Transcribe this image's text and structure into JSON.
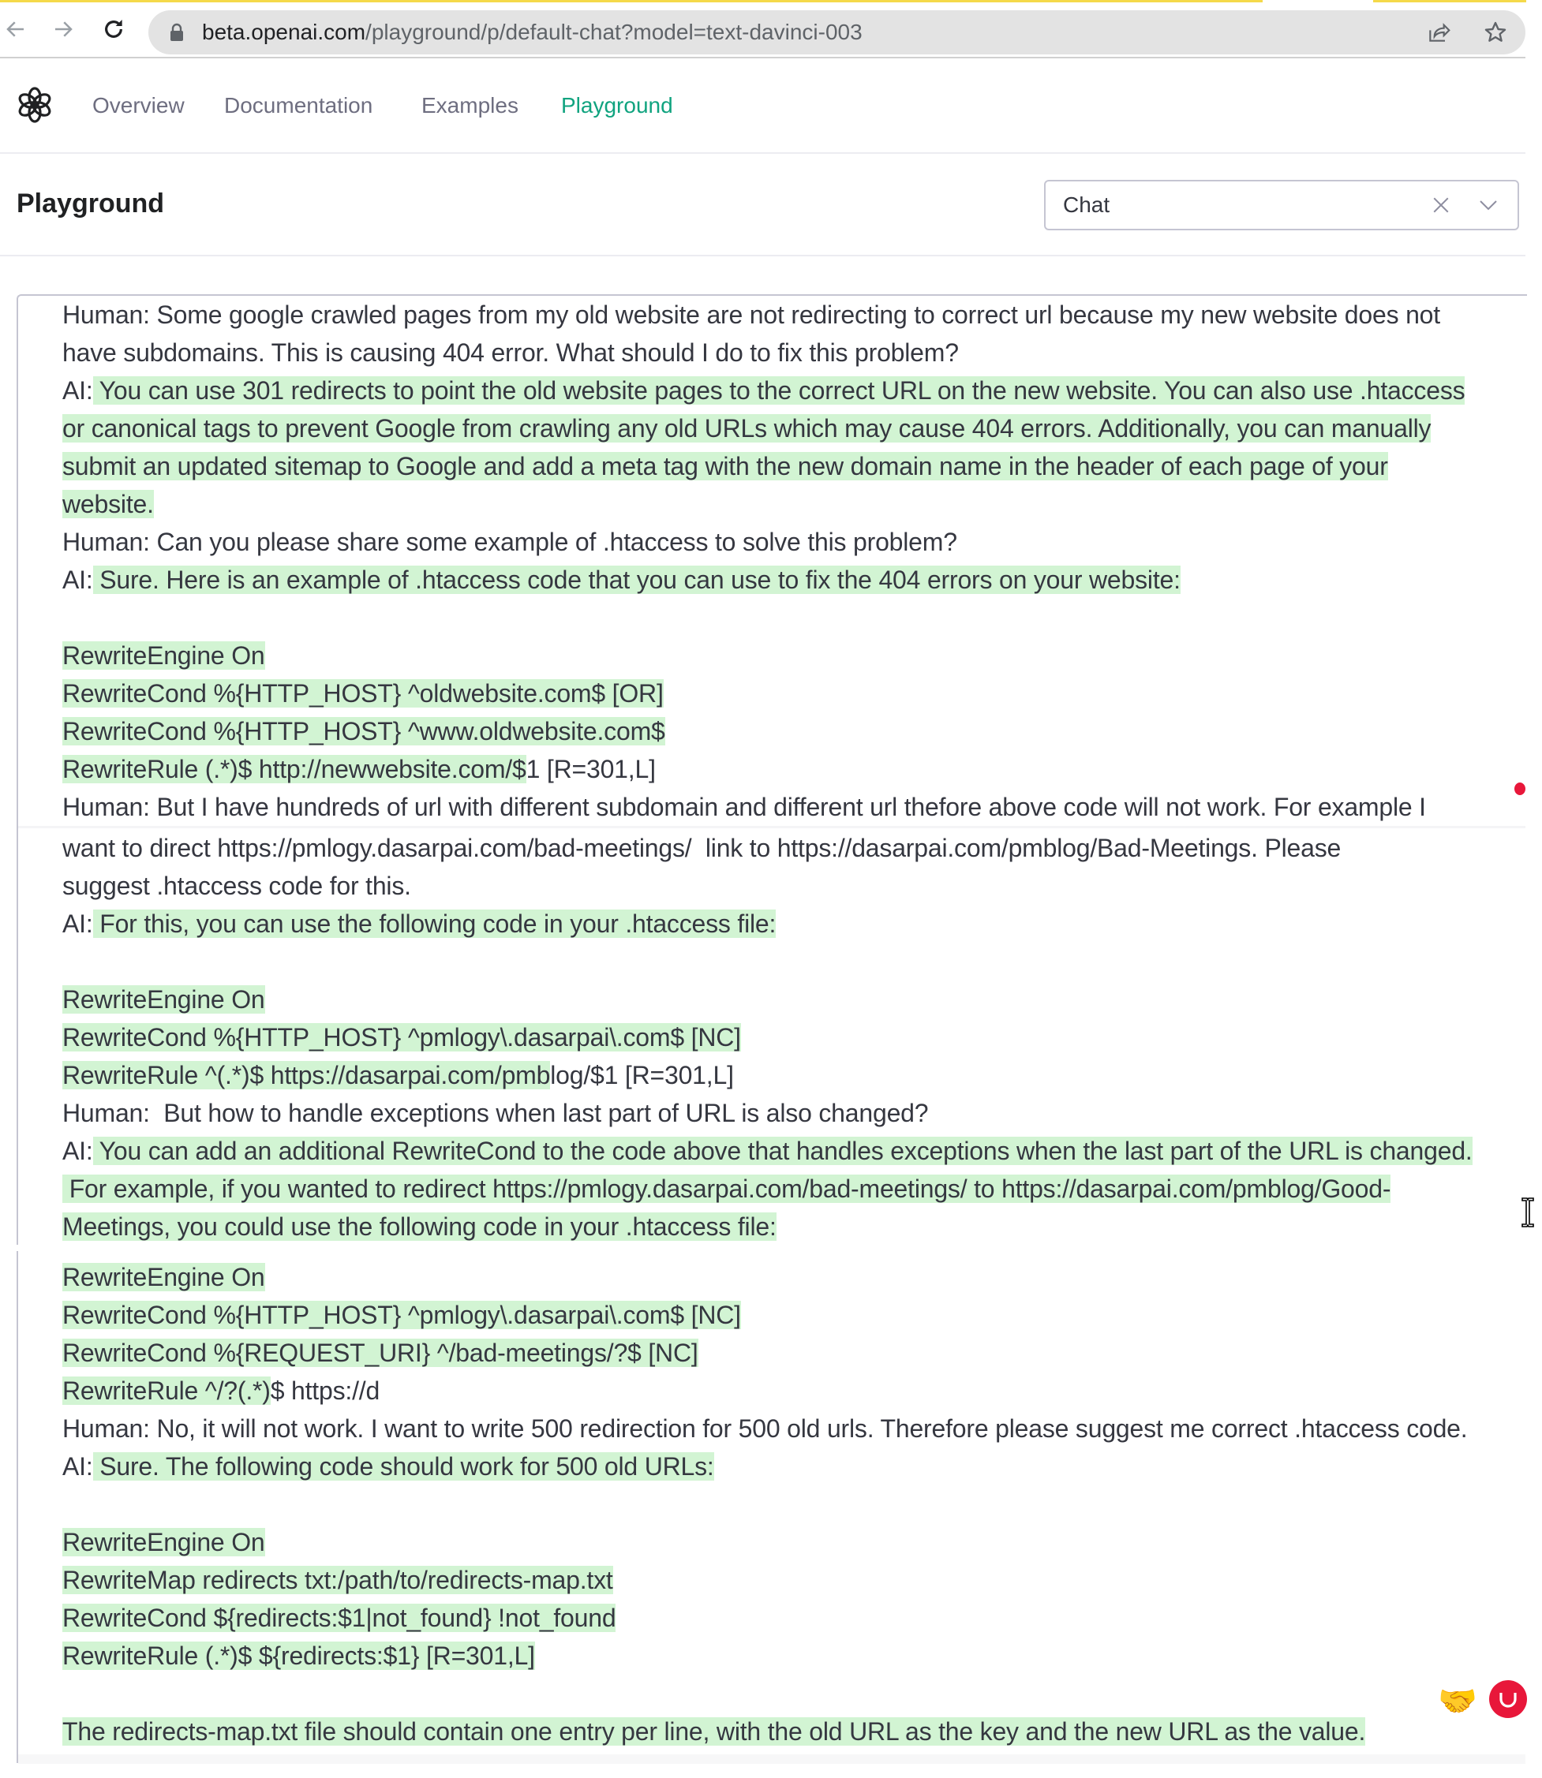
{
  "browser": {
    "url_host": "beta.openai.com",
    "url_path": "/playground/p/default-chat?model=text-davinci-003",
    "icons": [
      "back-icon",
      "forward-icon",
      "reload-icon",
      "lock-icon",
      "share-icon",
      "star-icon"
    ]
  },
  "nav": {
    "logo": "openai-logo",
    "links": [
      {
        "label": "Overview",
        "active": false
      },
      {
        "label": "Documentation",
        "active": false
      },
      {
        "label": "Examples",
        "active": false
      },
      {
        "label": "Playground",
        "active": true
      }
    ],
    "active_color": "#10a37f"
  },
  "header": {
    "title": "Playground",
    "mode_select": {
      "value": "Chat"
    }
  },
  "editor": {
    "highlight_color": "#d2f4d3",
    "lines": [
      {
        "segments": [
          {
            "t": "Human: Some google crawled pages from my old website are not redirecting to correct url because my new website does not",
            "h": false
          }
        ]
      },
      {
        "segments": [
          {
            "t": "have subdomains. This is causing 404 error. What should I do to fix this problem?",
            "h": false
          }
        ]
      },
      {
        "segments": [
          {
            "t": "AI:",
            "h": false
          },
          {
            "t": " You can use 301 redirects to point the old website pages to the correct URL on the new website. You can also use .htaccess",
            "h": true
          }
        ]
      },
      {
        "segments": [
          {
            "t": "or canonical tags to prevent Google from crawling any old URLs which may cause 404 errors. Additionally, you can manually",
            "h": true
          }
        ]
      },
      {
        "segments": [
          {
            "t": "submit an updated sitemap to Google and add a meta tag with the new domain name in the header of each page of your",
            "h": true
          }
        ]
      },
      {
        "segments": [
          {
            "t": "website.",
            "h": true
          }
        ]
      },
      {
        "segments": [
          {
            "t": "Human: Can you please share some example of .htaccess to solve this problem?",
            "h": false
          }
        ]
      },
      {
        "segments": [
          {
            "t": "AI:",
            "h": false
          },
          {
            "t": " Sure. Here is an example of .htaccess code that you can use to fix the 404 errors on your website:",
            "h": true
          }
        ]
      },
      {
        "segments": []
      },
      {
        "segments": [
          {
            "t": "RewriteEngine On",
            "h": true
          }
        ]
      },
      {
        "segments": [
          {
            "t": "RewriteCond %{HTTP_HOST} ^oldwebsite.com$ [OR]",
            "h": true
          }
        ]
      },
      {
        "segments": [
          {
            "t": "RewriteCond %{HTTP_HOST} ^www.oldwebsite.com$",
            "h": true
          }
        ]
      },
      {
        "segments": [
          {
            "t": "RewriteRule (.*)$ http://newwebsite.com/$",
            "h": true
          },
          {
            "t": "1 [R=301,L]",
            "h": false
          }
        ]
      },
      {
        "segments": [
          {
            "t": "Human: But I have hundreds of url with different subdomain and different url thefore above code will not work. For example I",
            "h": false
          }
        ]
      },
      {
        "segments": [
          {
            "t": "want to direct https://pmlogy.dasarpai.com/bad-meetings/  link to https://dasarpai.com/pmblog/Bad-Meetings. Please",
            "h": false
          }
        ]
      },
      {
        "segments": [
          {
            "t": "suggest .htaccess code for this.",
            "h": false
          }
        ]
      },
      {
        "segments": [
          {
            "t": "AI:",
            "h": false
          },
          {
            "t": " For this, you can use the following code in your .htaccess file:",
            "h": true
          }
        ]
      },
      {
        "segments": []
      },
      {
        "segments": [
          {
            "t": "RewriteEngine On",
            "h": true
          }
        ]
      },
      {
        "segments": [
          {
            "t": "RewriteCond %{HTTP_HOST} ^pmlogy\\.dasarpai\\.com$ [NC]",
            "h": true
          }
        ]
      },
      {
        "segments": [
          {
            "t": "RewriteRule ^(.*)$ https://dasarpai.com/pmb",
            "h": true
          },
          {
            "t": "log/$1 [R=301,L]",
            "h": false
          }
        ]
      },
      {
        "segments": [
          {
            "t": "Human:  But how to handle exceptions when last part of URL is also changed?",
            "h": false
          }
        ]
      },
      {
        "segments": [
          {
            "t": "AI:",
            "h": false
          },
          {
            "t": " You can add an additional RewriteCond to the code above that handles exceptions when the last part of the URL is changed.",
            "h": true
          }
        ]
      },
      {
        "segments": [
          {
            "t": " For example, if you wanted to redirect https://pmlogy.dasarpai.com/bad-meetings/ to https://dasarpai.com/pmblog/Good-",
            "h": true
          }
        ]
      },
      {
        "segments": [
          {
            "t": "Meetings, you could use the following code in your .htaccess file:",
            "h": true
          }
        ]
      },
      {
        "segments": [
          {
            "t": "RewriteEngine On",
            "h": true
          }
        ]
      },
      {
        "segments": [
          {
            "t": "RewriteCond %{HTTP_HOST} ^pmlogy\\.dasarpai\\.com$ [NC]",
            "h": true
          }
        ]
      },
      {
        "segments": [
          {
            "t": "RewriteCond %{REQUEST_URI} ^/bad-meetings/?$ [NC]",
            "h": true
          }
        ]
      },
      {
        "segments": [
          {
            "t": "RewriteRule ^/?(.*)",
            "h": true
          },
          {
            "t": "$ https://d",
            "h": false
          }
        ]
      },
      {
        "segments": [
          {
            "t": "Human: No, it will not work. I want to write 500 redirection for 500 old urls. Therefore please suggest me correct .htaccess code.",
            "h": false
          }
        ]
      },
      {
        "segments": [
          {
            "t": "AI:",
            "h": false
          },
          {
            "t": " Sure. The following code should work for 500 old URLs:",
            "h": true
          }
        ]
      },
      {
        "segments": []
      },
      {
        "segments": [
          {
            "t": "RewriteEngine On",
            "h": true
          }
        ]
      },
      {
        "segments": [
          {
            "t": "RewriteMap redirects txt:/path/to/redirects-map.txt",
            "h": true
          }
        ]
      },
      {
        "segments": [
          {
            "t": "RewriteCond ${redirects:$1|not_found} !not_found",
            "h": true
          }
        ]
      },
      {
        "segments": [
          {
            "t": "RewriteRule (.*)$ ${redirects:$1} [R=301,L]",
            "h": true
          }
        ]
      },
      {
        "segments": []
      },
      {
        "segments": [
          {
            "t": "The redirects-map.txt file should contain one entry per line, with the old URL as the key and the new URL as the value.",
            "h": true
          }
        ]
      }
    ]
  },
  "overlays": {
    "handshake_emoji": "🤝",
    "icons": [
      "recording-dot-icon",
      "text-cursor-icon",
      "handshake-icon",
      "avatar-icon"
    ]
  }
}
